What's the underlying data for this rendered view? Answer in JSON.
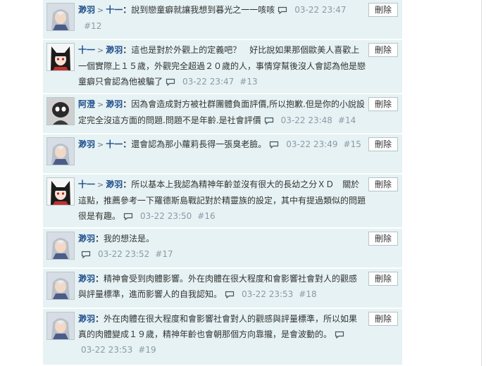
{
  "delete_label": "刪除",
  "colors": {
    "item_bg": "#e6f2f3",
    "username": "#1f4e8c",
    "meta": "#8a9aa8",
    "text": "#333333"
  },
  "comments": [
    {
      "avatar": "silver-hair-avatar",
      "from": "渺羽",
      "arrow": ">",
      "to": "十一",
      "text": "說到戀童癖就讓我想到暮光之一一咳咳",
      "time": "03-22 23:47",
      "index": "#12"
    },
    {
      "avatar": "cat-ears-avatar",
      "from": "十一",
      "arrow": ">",
      "to": "渺羽",
      "text": "這也是對於外觀上的定義吧？　好比說如果那個歐美人喜歡上一個實際上１５歲，外觀完全超過２０歲的人，事情穿幫後沒人會認為他是戀童癖只會認為他被騙了",
      "time": "03-22 23:47",
      "index": "#13"
    },
    {
      "avatar": "dark-mask-avatar",
      "from": "阿澄",
      "arrow": ">",
      "to": "渺羽",
      "text": "因為會造成對方被社群團體負面評價,所以抱歉.但是你的小說設定完全沒這方面的問題.問題不是年齡.是社會評價",
      "time": "03-22 23:48",
      "index": "#14"
    },
    {
      "avatar": "silver-hair-avatar",
      "from": "渺羽",
      "arrow": ">",
      "to": "十一",
      "text": "還會認為那小蘿莉長得一張臭老臉。",
      "time": "03-22 23:49",
      "index": "#15"
    },
    {
      "avatar": "cat-ears-avatar",
      "from": "十一",
      "arrow": ">",
      "to": "渺羽",
      "text": "所以基本上我認為精神年齡並沒有很大的長幼之分ＸＤ　關於這點，推薦參考一下羅德斯島戰記對於精靈族的設定，其中有提過類似的問題很是有趣。",
      "time": "03-22 23:50",
      "index": "#16"
    },
    {
      "avatar": "silver-hair-avatar",
      "from": "渺羽",
      "arrow": "",
      "to": "",
      "text": "我的想法是。",
      "time": "03-22 23:52",
      "index": "#17"
    },
    {
      "avatar": "silver-hair-avatar",
      "from": "渺羽",
      "arrow": "",
      "to": "",
      "text": "精神會受到肉體影響。外在肉體在很大程度和會影響社會對人的觀感與評量標準，進而影響人的自我認知。",
      "time": "03-22 23:53",
      "index": "#18"
    },
    {
      "avatar": "silver-hair-avatar",
      "from": "渺羽",
      "arrow": "",
      "to": "",
      "text": "外在肉體在很大程度和會影響社會對人的觀感與評量標準，所以如果真的肉體變成１９歲，精神年齡也會朝那個方向靠攏，是會波動的。",
      "time": "03-22 23:53",
      "index": "#19"
    }
  ]
}
